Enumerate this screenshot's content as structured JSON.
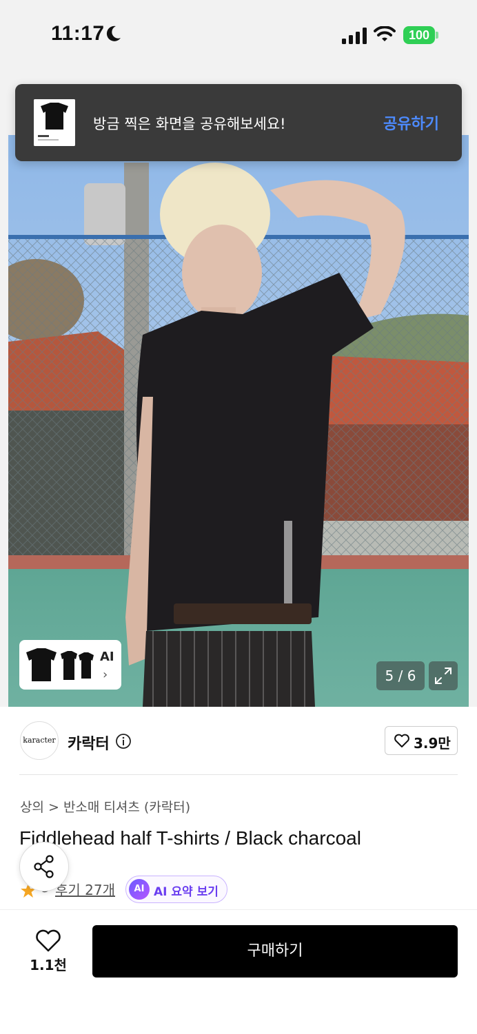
{
  "status_bar": {
    "time": "11:17",
    "battery": "100"
  },
  "toast": {
    "message": "방금 찍은 화면을 공유해보세요!",
    "action_label": "공유하기"
  },
  "gallery": {
    "ai_label": "AI",
    "ai_chevron": "›",
    "counter": "5 / 6"
  },
  "brand": {
    "logo_text": "karacter",
    "name": "카락터",
    "like_count": "3.9만"
  },
  "product": {
    "breadcrumb": "상의 > 반소매 티셔츠 (카락터)",
    "title": "Fiddlehead half T-shirts / Black charcoal",
    "rating": "5",
    "review_label": "후기 27개",
    "ai_badge": "AI",
    "ai_summary_label": "AI 요약 보기"
  },
  "bottom": {
    "wishlist_count": "1.1천",
    "buy_label": "구매하기"
  },
  "icons": [
    "moon-icon",
    "signal-icon",
    "wifi-icon",
    "battery-icon",
    "expand-icon",
    "info-icon",
    "heart-icon",
    "star-icon",
    "share-icon"
  ],
  "colors": {
    "accent_blue": "#4d8bff",
    "battery_green": "#2fcf55",
    "star_orange": "#f5a623",
    "ai_purple": "#6a3df0"
  }
}
